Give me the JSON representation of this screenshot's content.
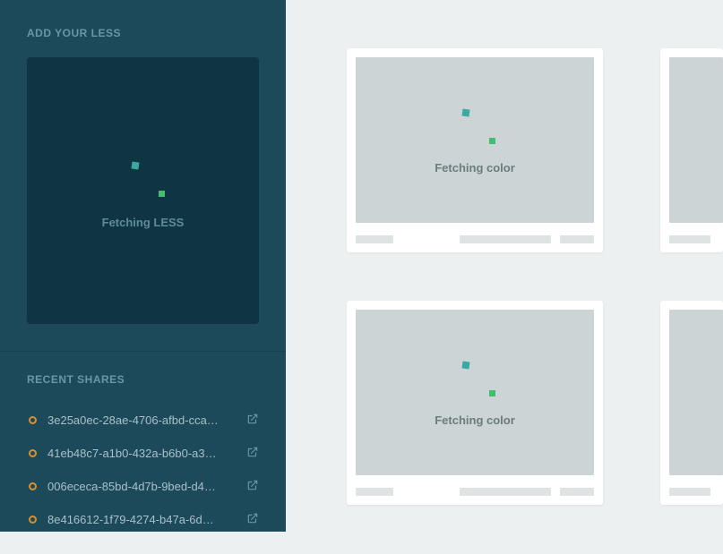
{
  "sidebar": {
    "add_title": "ADD YOUR LESS",
    "fetch_less": "Fetching LESS",
    "shares_title": "RECENT SHARES",
    "shares": [
      {
        "label": "3e25a0ec-28ae-4706-afbd-cca…"
      },
      {
        "label": "41eb48c7-a1b0-432a-b6b0-a3…"
      },
      {
        "label": "006ececa-85bd-4d7b-9bed-d4…"
      },
      {
        "label": "8e416612-1f79-4274-b47a-6d…"
      }
    ]
  },
  "main": {
    "fetch_color": "Fetching color"
  }
}
